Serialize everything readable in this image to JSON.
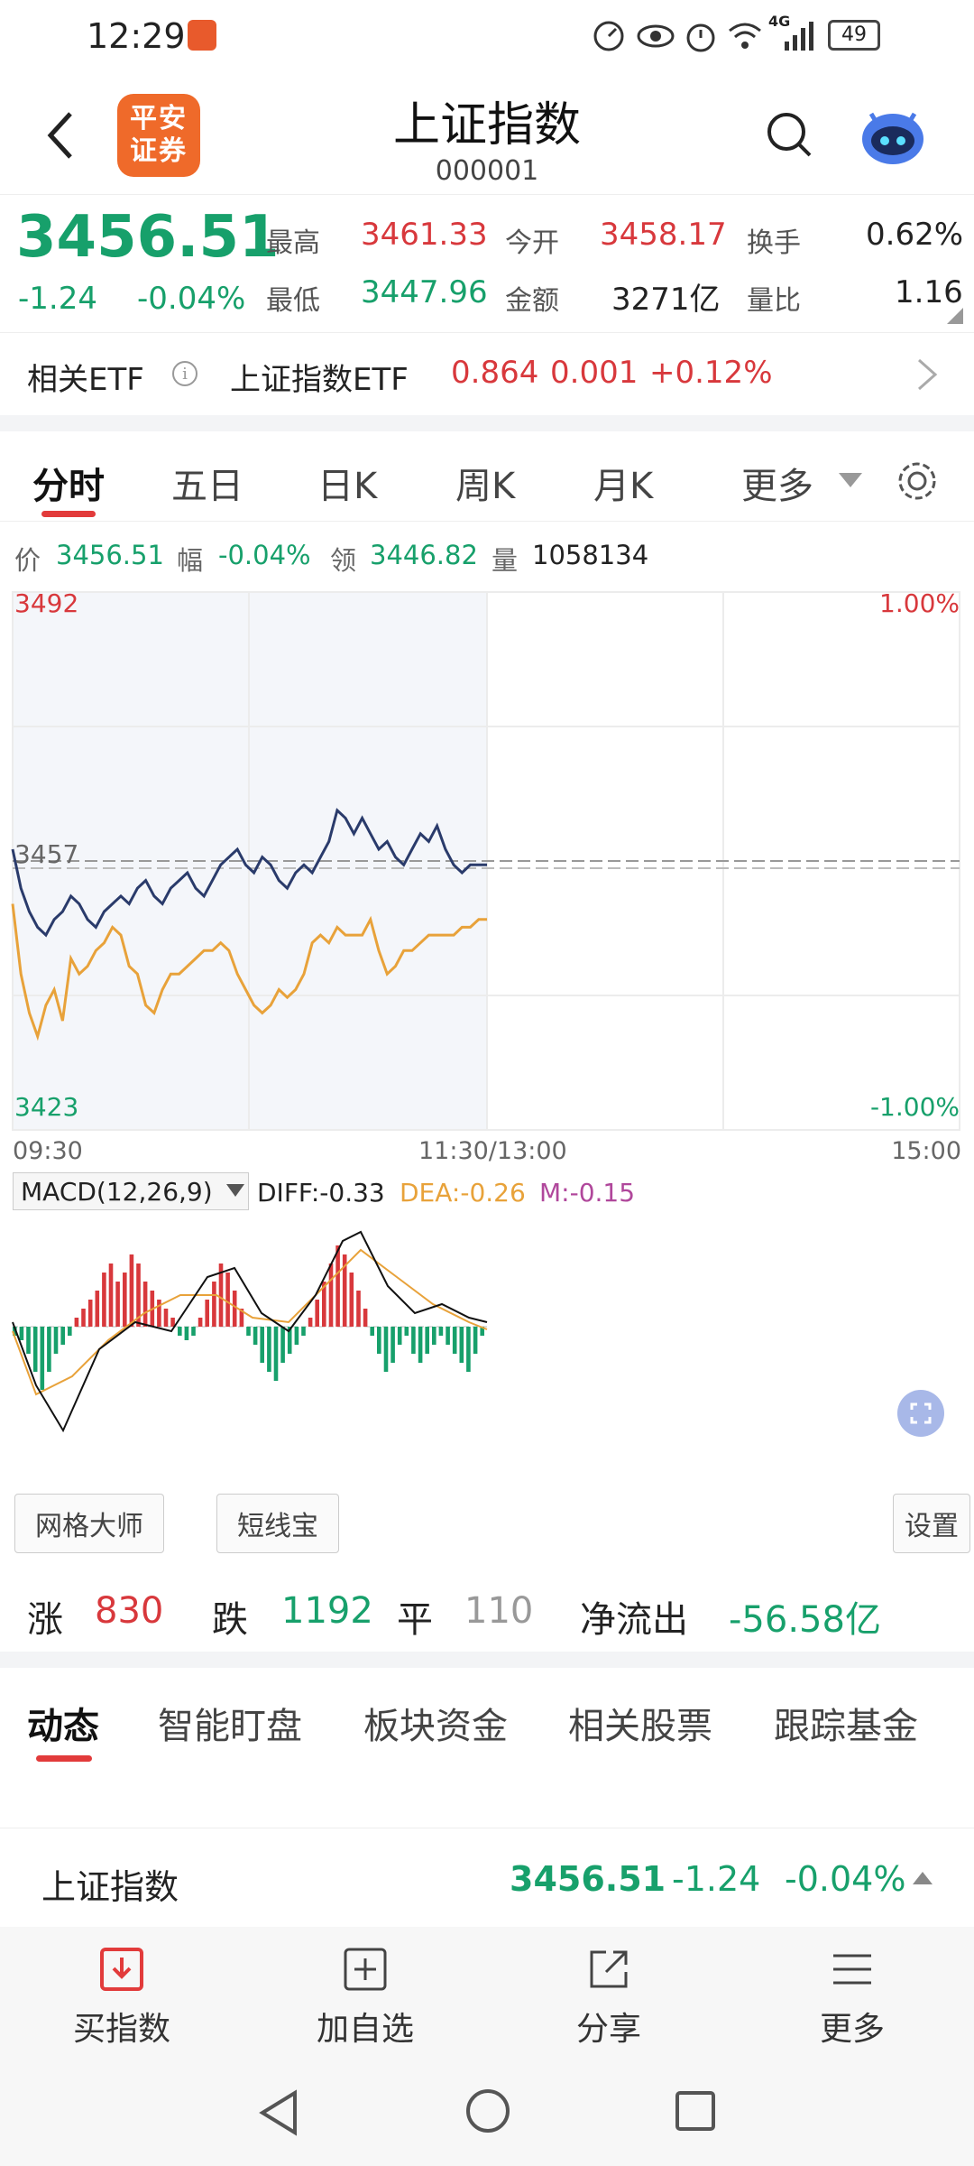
{
  "status_bar": {
    "time": "12:29",
    "network": "4G",
    "battery": "49"
  },
  "header": {
    "title": "上证指数",
    "code": "000001",
    "broker_logo": "平安证券"
  },
  "quote": {
    "price": "3456.51",
    "change": "-1.24",
    "change_pct": "-0.04%",
    "high_label": "最高",
    "high": "3461.33",
    "open_label": "今开",
    "open": "3458.17",
    "turnover_label": "换手",
    "turnover": "0.62%",
    "low_label": "最低",
    "low": "3447.96",
    "amount_label": "金额",
    "amount": "3271亿",
    "vol_ratio_label": "量比",
    "vol_ratio": "1.16"
  },
  "etf": {
    "label": "相关ETF",
    "name": "上证指数ETF",
    "price": "0.864",
    "change": "0.001",
    "change_pct": "+0.12%"
  },
  "tabs": [
    "分时",
    "五日",
    "日K",
    "周K",
    "月K",
    "更多"
  ],
  "info_line": {
    "price_label": "价",
    "price": "3456.51",
    "pct_label": "幅",
    "pct": "-0.04%",
    "lead_label": "领",
    "lead": "3446.82",
    "vol_label": "量",
    "vol": "1058134"
  },
  "chart": {
    "y_top": "3492",
    "y_mid": "3457",
    "y_bottom": "3423",
    "pct_top": "1.00%",
    "pct_bottom": "-1.00%",
    "x_start": "09:30",
    "x_mid": "11:30/13:00",
    "x_end": "15:00"
  },
  "chart_data": {
    "type": "line",
    "series": [
      {
        "values": [
          3459,
          3454,
          3451,
          3449,
          3448,
          3450,
          3451,
          3453,
          3452,
          3450,
          3449,
          3451,
          3452,
          3453,
          3452,
          3454,
          3455,
          3453,
          3452,
          3454,
          3455,
          3456,
          3454,
          3453,
          3455,
          3457,
          3458,
          3459,
          3457,
          3456,
          3458,
          3457,
          3455,
          3454,
          3456,
          3457,
          3456,
          3458,
          3460,
          3464,
          3463,
          3461,
          3463,
          3461,
          3459,
          3460,
          3458,
          3457,
          3459,
          3461,
          3460,
          3462,
          3459,
          3457,
          3456,
          3457,
          3457,
          3457
        ]
      },
      {
        "values": [
          3452,
          3443,
          3438,
          3435,
          3439,
          3441,
          3437,
          3445,
          3443,
          3444,
          3446,
          3447,
          3449,
          3448,
          3444,
          3443,
          3439,
          3438,
          3441,
          3443,
          3443,
          3444,
          3445,
          3446,
          3446,
          3447,
          3446,
          3443,
          3441,
          3439,
          3438,
          3439,
          3441,
          3440,
          3441,
          3443,
          3447,
          3448,
          3447,
          3449,
          3448,
          3448,
          3448,
          3450,
          3446,
          3443,
          3444,
          3446,
          3446,
          3447,
          3448,
          3448,
          3448,
          3448,
          3449,
          3449,
          3450,
          3450
        ]
      }
    ],
    "ylim": [
      3423,
      3492
    ]
  },
  "macd": {
    "label": "MACD(12,26,9)",
    "diff": "DIFF:-0.33",
    "dea": "DEA:-0.26",
    "m": "M:-0.15",
    "bars": [
      -2,
      -3,
      -6,
      -10,
      -14,
      -10,
      -6,
      -4,
      -2,
      2,
      4,
      6,
      8,
      12,
      14,
      10,
      12,
      16,
      14,
      10,
      8,
      6,
      4,
      2,
      -2,
      -3,
      -2,
      2,
      6,
      10,
      14,
      12,
      8,
      4,
      -2,
      -4,
      -8,
      -10,
      -12,
      -8,
      -6,
      -4,
      -2,
      2,
      6,
      10,
      14,
      18,
      16,
      12,
      8,
      4,
      -2,
      -6,
      -10,
      -8,
      -4,
      -2,
      -6,
      -8,
      -6,
      -4,
      -2,
      -4,
      -6,
      -8,
      -10,
      -6,
      -2
    ]
  },
  "chips": {
    "grid_master": "网格大师",
    "short_line": "短线宝",
    "settings": "设置"
  },
  "breadth": {
    "up_label": "涨",
    "up": "830",
    "down_label": "跌",
    "down": "1192",
    "flat_label": "平",
    "flat": "110",
    "net_label": "净流出",
    "net": "-56.58亿"
  },
  "news_tabs": [
    "动态",
    "智能盯盘",
    "板块资金",
    "相关股票",
    "跟踪基金"
  ],
  "ticker": {
    "name": "上证指数",
    "price": "3456.51",
    "change": "-1.24",
    "pct": "-0.04%"
  },
  "bottom_nav": [
    "买指数",
    "加自选",
    "分享",
    "更多"
  ],
  "colors": {
    "up": "#d8383c",
    "down": "#17a06b",
    "price_line": "#2a3b6b",
    "avg_line": "#e8a23a",
    "accent": "#e23b3b"
  }
}
